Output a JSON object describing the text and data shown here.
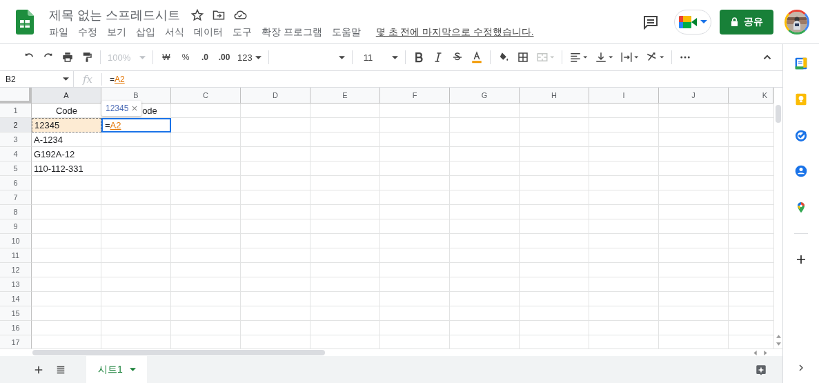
{
  "document": {
    "title": "제목 없는 스프레드시트",
    "last_edit": "몇 초 전에 마지막으로 수정했습니다."
  },
  "menu": [
    "파일",
    "수정",
    "보기",
    "삽입",
    "서식",
    "데이터",
    "도구",
    "확장 프로그램",
    "도움말"
  ],
  "share_button": {
    "label": "공유"
  },
  "toolbar": {
    "zoom": {
      "value": "100%",
      "disabled": true
    },
    "currency": "₩",
    "percent": "%",
    "decimal_decrease": ".0",
    "decimal_increase": ".00",
    "number_format": "123",
    "font_size": "11",
    "merge": {
      "disabled": true
    }
  },
  "formula_bar": {
    "name_box": "B2",
    "fx": "fx",
    "prefix": "=",
    "ref": "A2"
  },
  "grid": {
    "columns": [
      {
        "label": "A",
        "selected": true
      },
      {
        "label": "B",
        "selected": false
      },
      {
        "label": "C",
        "selected": false
      },
      {
        "label": "D",
        "selected": false
      },
      {
        "label": "E",
        "selected": false
      },
      {
        "label": "F",
        "selected": false
      },
      {
        "label": "G",
        "selected": false
      },
      {
        "label": "H",
        "selected": false
      },
      {
        "label": "I",
        "selected": false
      },
      {
        "label": "J",
        "selected": false
      },
      {
        "label": "K",
        "selected": false
      }
    ],
    "rows": [
      {
        "label": "1",
        "selected": false,
        "cells": [
          {
            "kind": "text",
            "text": "Code",
            "centered": true
          },
          {
            "kind": "text",
            "text": "ode",
            "centered": true
          }
        ]
      },
      {
        "label": "2",
        "selected": true,
        "cells": [
          {
            "kind": "referenced",
            "text": "12345",
            "centered": false
          },
          {
            "kind": "active_formula",
            "prefix": "=",
            "ref": "A2"
          }
        ]
      },
      {
        "label": "3",
        "selected": false,
        "cells": [
          {
            "kind": "text",
            "text": "A-1234",
            "centered": false
          }
        ]
      },
      {
        "label": "4",
        "selected": false,
        "cells": [
          {
            "kind": "text",
            "text": "G192A-12",
            "centered": false
          }
        ]
      },
      {
        "label": "5",
        "selected": false,
        "cells": [
          {
            "kind": "text",
            "text": "110-112-331",
            "centered": false
          }
        ]
      },
      {
        "label": "6",
        "selected": false,
        "cells": []
      },
      {
        "label": "7",
        "selected": false,
        "cells": []
      },
      {
        "label": "8",
        "selected": false,
        "cells": []
      },
      {
        "label": "9",
        "selected": false,
        "cells": []
      },
      {
        "label": "10",
        "selected": false,
        "cells": []
      },
      {
        "label": "11",
        "selected": false,
        "cells": []
      },
      {
        "label": "12",
        "selected": false,
        "cells": []
      },
      {
        "label": "13",
        "selected": false,
        "cells": []
      },
      {
        "label": "14",
        "selected": false,
        "cells": []
      },
      {
        "label": "15",
        "selected": false,
        "cells": []
      },
      {
        "label": "16",
        "selected": false,
        "cells": []
      },
      {
        "label": "17",
        "selected": false,
        "cells": []
      }
    ],
    "tooltip": {
      "value": "12345"
    }
  },
  "sheets": [
    {
      "name": "시트1",
      "selected": true
    }
  ]
}
